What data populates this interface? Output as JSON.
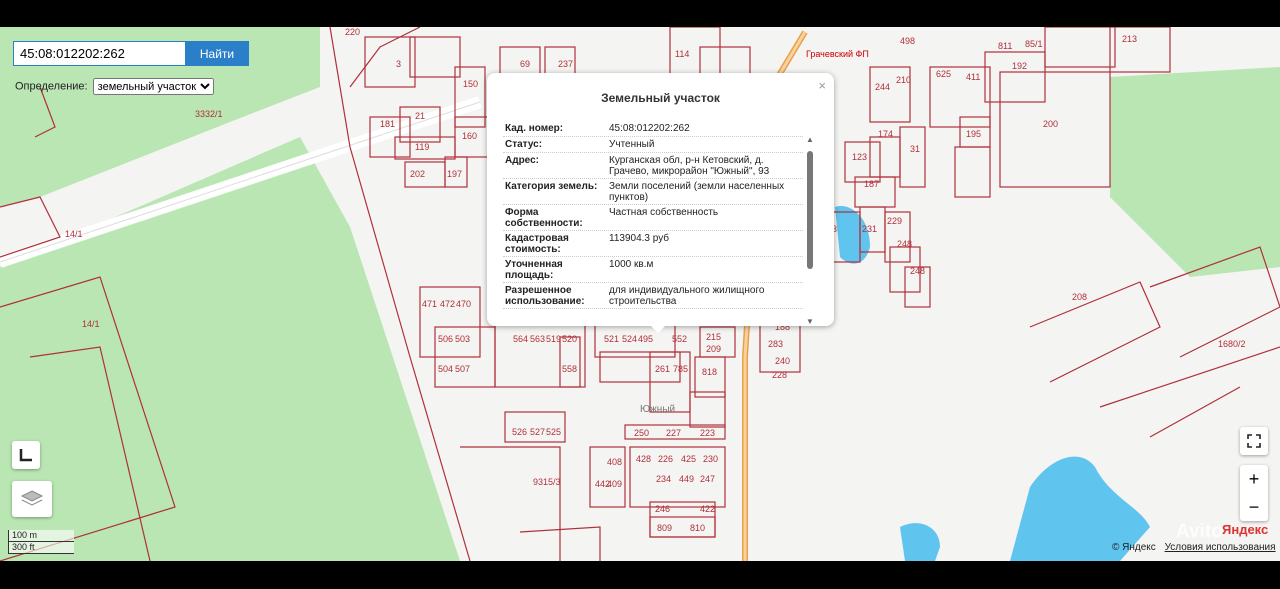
{
  "search": {
    "value": "45:08:012202:262",
    "button_label": "Найти"
  },
  "definition": {
    "label": "Определение:",
    "selected": "земельный участок"
  },
  "popup": {
    "title": "Земельный участок",
    "rows": [
      {
        "key": "Кад. номер:",
        "value": "45:08:012202:262"
      },
      {
        "key": "Статус:",
        "value": "Учтенный"
      },
      {
        "key": "Адрес:",
        "value": "Курганская обл, р-н Кетовский, д. Грачево, микрорайон \"Южный\", 93"
      },
      {
        "key": "Категория земель:",
        "value": "Земли поселений (земли населенных пунктов)"
      },
      {
        "key": "Форма собственности:",
        "value": "Частная собственность"
      },
      {
        "key": "Кадастровая стоимость:",
        "value": "113904.3 руб"
      },
      {
        "key": "Уточненная площадь:",
        "value": "1000 кв.м"
      },
      {
        "key": "Разрешенное использование:",
        "value": "для индивидуального жилищного строительства"
      }
    ]
  },
  "map_labels": {
    "south": "Южный",
    "gp": "Грачевский ФП",
    "p3332": "3332/1",
    "p14a": "14/1",
    "p14b": "14/1",
    "p200": "200",
    "p208": "208",
    "p1680": "1680/2",
    "p9315": "9315/3",
    "n119": "119",
    "n202": "202",
    "n197": "197",
    "n150": "150",
    "n237": "237",
    "n498": "498",
    "n244": "244",
    "n210": "210",
    "n625": "625",
    "n411": "411",
    "n811": "811",
    "n192": "192",
    "n85": "85/1",
    "n213": "213",
    "n195": "195",
    "n123": "123",
    "n174": "174",
    "n31": "31",
    "n187": "187",
    "n233": "233",
    "n231": "231",
    "n229": "229",
    "n248a": "248",
    "n248b": "248",
    "n471": "471",
    "n472": "472",
    "n470": "470",
    "n506": "506",
    "n503": "503",
    "n504": "504",
    "n507": "507",
    "n564": "564",
    "n563": "563",
    "n519": "519",
    "n520": "520",
    "n558": "558",
    "n521": "521",
    "n524": "524",
    "n495": "495",
    "n552": "552",
    "n261": "261",
    "n785": "785",
    "n215": "215",
    "n209": "209",
    "n818": "818",
    "n188": "188",
    "n283": "283",
    "n240": "240",
    "n228": "228",
    "n526": "526",
    "n527": "527",
    "n525": "525",
    "n250": "250",
    "n227": "227",
    "n223": "223",
    "n428": "428",
    "n226": "226",
    "n425": "425",
    "n230": "230",
    "n234": "234",
    "n449": "449",
    "n247": "247",
    "n246": "246",
    "n422": "422",
    "n809": "809",
    "n810": "810",
    "n442": "442",
    "n408": "408",
    "n409": "409",
    "n220": "220",
    "n181": "181",
    "n21": "21",
    "n160": "160",
    "n3": "3",
    "n69": "69",
    "n114": "114"
  },
  "scale": {
    "m": "100 m",
    "ft": "300 ft"
  },
  "copyright": {
    "yandex": "© Яндекс",
    "terms": "Условия использования"
  },
  "brand": {
    "yandex": "Яндекс",
    "avito": "Avito"
  },
  "icons": {
    "fullscreen": "fullscreen-icon",
    "zoom_in": "+",
    "zoom_out": "−",
    "ruler": "ruler-icon",
    "layers": "layers-icon",
    "close": "×"
  },
  "colors": {
    "parcel": "#b0303a",
    "forest": "#b9e6b2",
    "water": "#5fc4ee",
    "road": "#e8a14a",
    "button": "#2b7fc9"
  }
}
